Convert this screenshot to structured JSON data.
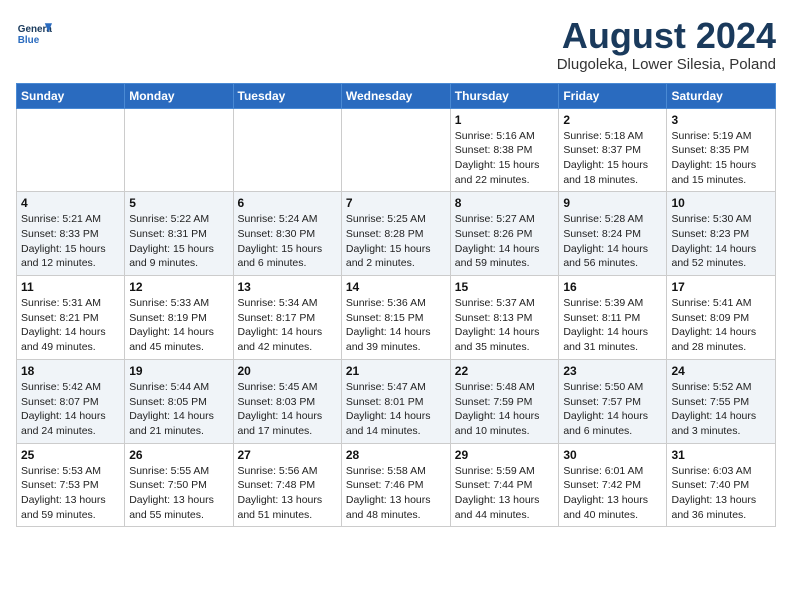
{
  "header": {
    "logo_general": "General",
    "logo_blue": "Blue",
    "month_title": "August 2024",
    "location": "Dlugoleka, Lower Silesia, Poland"
  },
  "days_of_week": [
    "Sunday",
    "Monday",
    "Tuesday",
    "Wednesday",
    "Thursday",
    "Friday",
    "Saturday"
  ],
  "weeks": [
    [
      {
        "day": "",
        "info": ""
      },
      {
        "day": "",
        "info": ""
      },
      {
        "day": "",
        "info": ""
      },
      {
        "day": "",
        "info": ""
      },
      {
        "day": "1",
        "info": "Sunrise: 5:16 AM\nSunset: 8:38 PM\nDaylight: 15 hours\nand 22 minutes."
      },
      {
        "day": "2",
        "info": "Sunrise: 5:18 AM\nSunset: 8:37 PM\nDaylight: 15 hours\nand 18 minutes."
      },
      {
        "day": "3",
        "info": "Sunrise: 5:19 AM\nSunset: 8:35 PM\nDaylight: 15 hours\nand 15 minutes."
      }
    ],
    [
      {
        "day": "4",
        "info": "Sunrise: 5:21 AM\nSunset: 8:33 PM\nDaylight: 15 hours\nand 12 minutes."
      },
      {
        "day": "5",
        "info": "Sunrise: 5:22 AM\nSunset: 8:31 PM\nDaylight: 15 hours\nand 9 minutes."
      },
      {
        "day": "6",
        "info": "Sunrise: 5:24 AM\nSunset: 8:30 PM\nDaylight: 15 hours\nand 6 minutes."
      },
      {
        "day": "7",
        "info": "Sunrise: 5:25 AM\nSunset: 8:28 PM\nDaylight: 15 hours\nand 2 minutes."
      },
      {
        "day": "8",
        "info": "Sunrise: 5:27 AM\nSunset: 8:26 PM\nDaylight: 14 hours\nand 59 minutes."
      },
      {
        "day": "9",
        "info": "Sunrise: 5:28 AM\nSunset: 8:24 PM\nDaylight: 14 hours\nand 56 minutes."
      },
      {
        "day": "10",
        "info": "Sunrise: 5:30 AM\nSunset: 8:23 PM\nDaylight: 14 hours\nand 52 minutes."
      }
    ],
    [
      {
        "day": "11",
        "info": "Sunrise: 5:31 AM\nSunset: 8:21 PM\nDaylight: 14 hours\nand 49 minutes."
      },
      {
        "day": "12",
        "info": "Sunrise: 5:33 AM\nSunset: 8:19 PM\nDaylight: 14 hours\nand 45 minutes."
      },
      {
        "day": "13",
        "info": "Sunrise: 5:34 AM\nSunset: 8:17 PM\nDaylight: 14 hours\nand 42 minutes."
      },
      {
        "day": "14",
        "info": "Sunrise: 5:36 AM\nSunset: 8:15 PM\nDaylight: 14 hours\nand 39 minutes."
      },
      {
        "day": "15",
        "info": "Sunrise: 5:37 AM\nSunset: 8:13 PM\nDaylight: 14 hours\nand 35 minutes."
      },
      {
        "day": "16",
        "info": "Sunrise: 5:39 AM\nSunset: 8:11 PM\nDaylight: 14 hours\nand 31 minutes."
      },
      {
        "day": "17",
        "info": "Sunrise: 5:41 AM\nSunset: 8:09 PM\nDaylight: 14 hours\nand 28 minutes."
      }
    ],
    [
      {
        "day": "18",
        "info": "Sunrise: 5:42 AM\nSunset: 8:07 PM\nDaylight: 14 hours\nand 24 minutes."
      },
      {
        "day": "19",
        "info": "Sunrise: 5:44 AM\nSunset: 8:05 PM\nDaylight: 14 hours\nand 21 minutes."
      },
      {
        "day": "20",
        "info": "Sunrise: 5:45 AM\nSunset: 8:03 PM\nDaylight: 14 hours\nand 17 minutes."
      },
      {
        "day": "21",
        "info": "Sunrise: 5:47 AM\nSunset: 8:01 PM\nDaylight: 14 hours\nand 14 minutes."
      },
      {
        "day": "22",
        "info": "Sunrise: 5:48 AM\nSunset: 7:59 PM\nDaylight: 14 hours\nand 10 minutes."
      },
      {
        "day": "23",
        "info": "Sunrise: 5:50 AM\nSunset: 7:57 PM\nDaylight: 14 hours\nand 6 minutes."
      },
      {
        "day": "24",
        "info": "Sunrise: 5:52 AM\nSunset: 7:55 PM\nDaylight: 14 hours\nand 3 minutes."
      }
    ],
    [
      {
        "day": "25",
        "info": "Sunrise: 5:53 AM\nSunset: 7:53 PM\nDaylight: 13 hours\nand 59 minutes."
      },
      {
        "day": "26",
        "info": "Sunrise: 5:55 AM\nSunset: 7:50 PM\nDaylight: 13 hours\nand 55 minutes."
      },
      {
        "day": "27",
        "info": "Sunrise: 5:56 AM\nSunset: 7:48 PM\nDaylight: 13 hours\nand 51 minutes."
      },
      {
        "day": "28",
        "info": "Sunrise: 5:58 AM\nSunset: 7:46 PM\nDaylight: 13 hours\nand 48 minutes."
      },
      {
        "day": "29",
        "info": "Sunrise: 5:59 AM\nSunset: 7:44 PM\nDaylight: 13 hours\nand 44 minutes."
      },
      {
        "day": "30",
        "info": "Sunrise: 6:01 AM\nSunset: 7:42 PM\nDaylight: 13 hours\nand 40 minutes."
      },
      {
        "day": "31",
        "info": "Sunrise: 6:03 AM\nSunset: 7:40 PM\nDaylight: 13 hours\nand 36 minutes."
      }
    ]
  ]
}
